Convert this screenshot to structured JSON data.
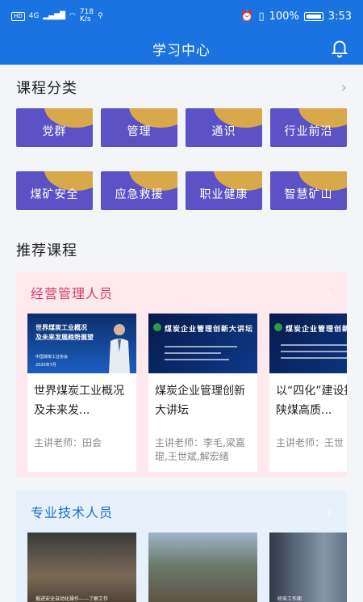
{
  "status": {
    "net_speed": "718\nK/s",
    "battery": "100%",
    "time": "3:53",
    "hd": "HD",
    "sig": "4G"
  },
  "header": {
    "title": "学习中心"
  },
  "categories": {
    "title": "课程分类",
    "more": "›",
    "items": [
      "党群",
      "管理",
      "通识",
      "行业前沿",
      "煤矿安全",
      "应急救援",
      "职业健康",
      "智慧矿山"
    ]
  },
  "recommended": {
    "title": "推荐课程"
  },
  "groups": [
    {
      "title": "经营管理人员",
      "more": "›",
      "courses": [
        {
          "name": "世界煤炭工业概况及未来发...",
          "teacher": "主讲老师：田会",
          "thumb_lines": [
            "世界煤炭工业概况",
            "及未来发展趋势展望",
            "中国煤炭工业协会",
            "2020年7月"
          ]
        },
        {
          "name": "煤炭企业管理创新大讲坛",
          "teacher": "主讲老师：李毛,梁嘉琨,王世斌,解宏绪",
          "thumb_lines": [
            "煤炭企业管理创新大讲坛"
          ]
        },
        {
          "name": "以“四化”建设推动陕煤高质...",
          "teacher": "主讲老师：王世",
          "thumb_lines": [
            "煤炭企业管理创新"
          ]
        }
      ]
    },
    {
      "title": "专业技术人员",
      "more": "›",
      "courses": [
        {
          "thumb_caption": "掘进安全自动化操作——了解工作"
        },
        {
          "thumb_caption": ""
        },
        {
          "thumb_caption": "综采工作面"
        }
      ]
    }
  ],
  "colors": {
    "primary": "#1a73e0",
    "category_bg": "#5d52c5",
    "category_blob": "#d8a94a",
    "pink_panel": "#fde9ee",
    "blue_panel": "#e6f1fb"
  }
}
